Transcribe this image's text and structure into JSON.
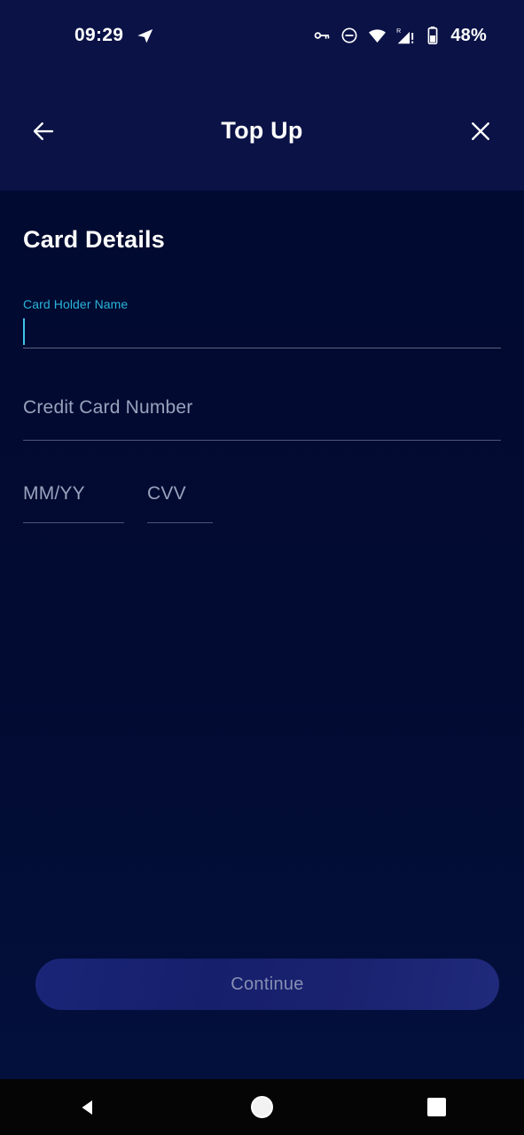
{
  "status_bar": {
    "time": "09:29",
    "notification_icon": "paper-plane-icon",
    "icons": [
      "vpn-key-icon",
      "do-not-disturb-icon",
      "wifi-icon",
      "cellular-roaming-icon"
    ],
    "battery_percent": "48%"
  },
  "header": {
    "back_icon": "arrow-left-icon",
    "title": "Top Up",
    "close_icon": "close-icon"
  },
  "main": {
    "page_title": "Card Details",
    "fields": [
      {
        "name": "card-holder-name",
        "label": "Card Holder Name",
        "value": "",
        "placeholder": "Card Holder Name",
        "state": "focused",
        "label_color": "#2ab3db"
      },
      {
        "name": "credit-card-number",
        "label": "",
        "value": "",
        "placeholder": "Credit Card Number",
        "state": "empty",
        "label_color": "#9aa2bd"
      },
      {
        "name": "expiry-date",
        "label": "",
        "value": "",
        "placeholder": "MM/YY",
        "state": "empty",
        "label_color": "#9aa2bd"
      },
      {
        "name": "cvv",
        "label": "",
        "value": "",
        "placeholder": "CVV",
        "state": "empty",
        "label_color": "#9aa2bd"
      }
    ]
  },
  "footer": {
    "continue_label": "Continue",
    "continue_enabled": false
  },
  "nav_bar": {
    "back_icon": "triangle-back-icon",
    "home_icon": "circle-home-icon",
    "recents_icon": "square-recents-icon"
  },
  "colors": {
    "header_bg": "#0a1246",
    "body_bg": "#020b2e",
    "accent": "#2ab3db",
    "muted_text": "#9aa2bd",
    "button_bg": "#1a2578",
    "nav_bg": "#050505"
  }
}
